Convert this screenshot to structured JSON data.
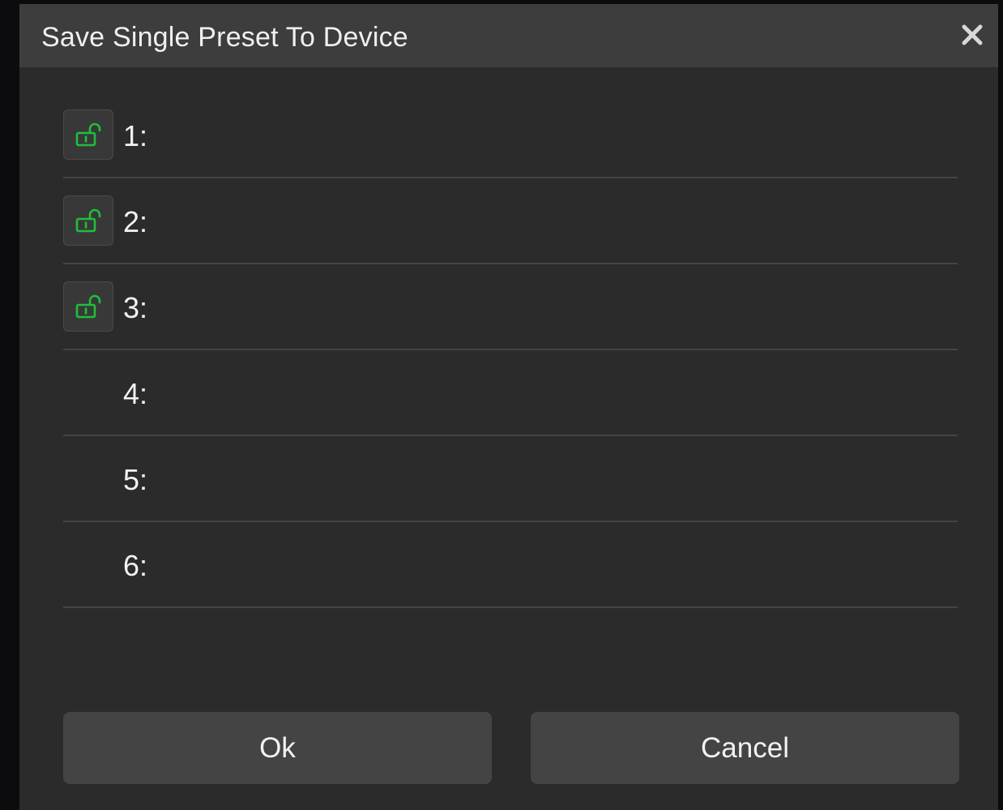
{
  "dialog": {
    "title": "Save Single Preset To Device",
    "close_icon": "close-icon"
  },
  "presets": [
    {
      "label": "1:",
      "locked": false,
      "show_lock": true,
      "icon": "unlock-icon"
    },
    {
      "label": "2:",
      "locked": false,
      "show_lock": true,
      "icon": "unlock-icon"
    },
    {
      "label": "3:",
      "locked": false,
      "show_lock": true,
      "icon": "unlock-icon"
    },
    {
      "label": "4:",
      "show_lock": false
    },
    {
      "label": "5:",
      "show_lock": false
    },
    {
      "label": "6:",
      "show_lock": false
    }
  ],
  "buttons": {
    "ok_label": "Ok",
    "cancel_label": "Cancel"
  },
  "colors": {
    "dialog_bg": "#2b2b2b",
    "titlebar_bg": "#3d3d3d",
    "button_bg": "#444444",
    "lock_icon": "#1fbf3a",
    "text": "#f2f2f2"
  }
}
